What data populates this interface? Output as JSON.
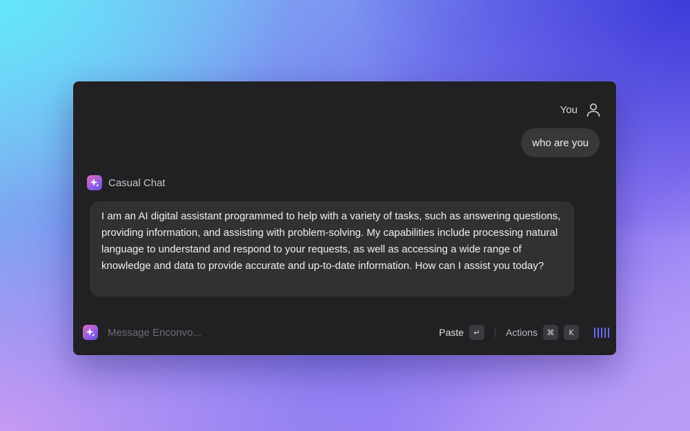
{
  "user": {
    "label": "You",
    "message": "who are you"
  },
  "assistant": {
    "name": "Casual Chat",
    "message": "I am an AI digital assistant programmed to help with a variety of tasks, such as answering questions, providing information, and assisting with problem-solving. My capabilities include processing natural language to understand and respond to your requests, as well as accessing a wide range of knowledge and data to provide accurate and up-to-date information. How can I assist you today?"
  },
  "composer": {
    "placeholder": "Message Enconvo...",
    "value": "",
    "paste_label": "Paste",
    "paste_key": "↵",
    "actions_label": "Actions",
    "actions_keys": [
      "⌘",
      "K"
    ]
  },
  "icons": {
    "user": "person-outline-icon",
    "assistant": "sparkle-icon",
    "voice": "voice-wave-icon"
  },
  "colors": {
    "window_bg": "#212124",
    "bubble_bg": "#313134",
    "accent": "#6c6cff",
    "app_icon_gradient": [
      "#e06ab8",
      "#9a5de0",
      "#5b54e8"
    ]
  }
}
